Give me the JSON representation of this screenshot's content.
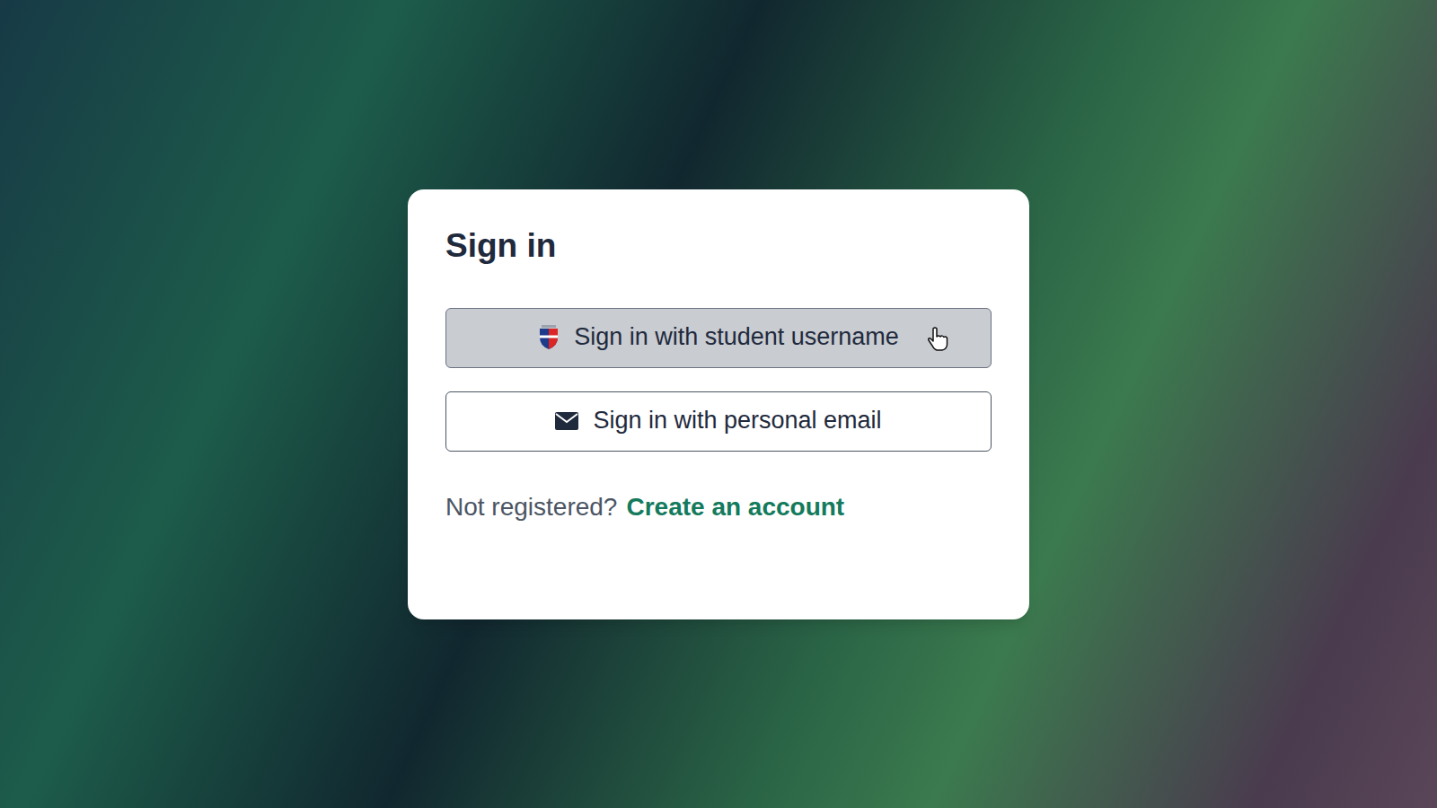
{
  "card": {
    "title": "Sign in"
  },
  "buttons": [
    {
      "label": "Sign in with student username",
      "kind": "crest",
      "hovered": true
    },
    {
      "label": "Sign in with personal email",
      "kind": "email",
      "hovered": false
    }
  ],
  "footer": {
    "prompt": "Not registered?",
    "link": "Create an account"
  }
}
